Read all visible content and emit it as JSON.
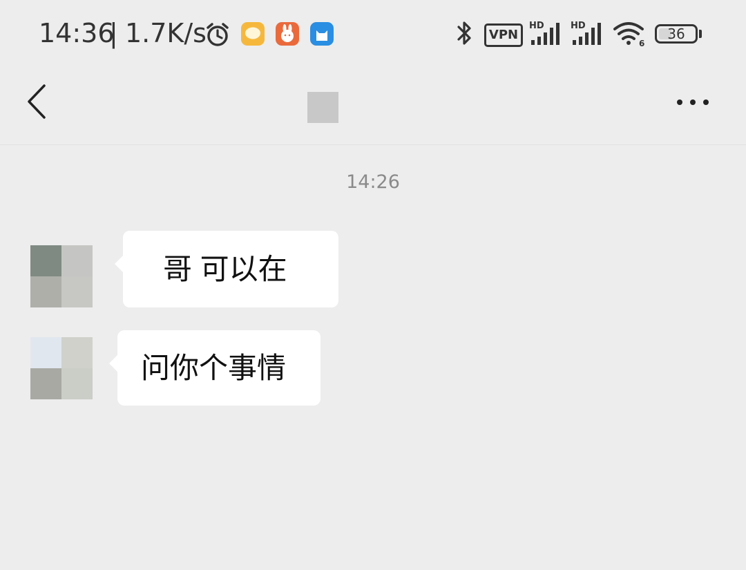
{
  "status_bar": {
    "time": "14:36",
    "separator": "|",
    "network_speed": "1.7K/s",
    "icons": [
      "alarm-icon",
      "messages-app-icon",
      "rabbit-app-icon",
      "cat-app-icon",
      "bluetooth-icon",
      "vpn-badge",
      "signal-hd-icon",
      "signal-hd-icon",
      "wifi-icon",
      "battery-icon"
    ],
    "vpn_label": "VPN",
    "signal_1_label": "HD",
    "signal_2_label": "HD",
    "wifi_label": "6",
    "battery_level": "36",
    "battery_fraction": 0.36
  },
  "nav_bar": {
    "back_icon": "chevron-left-icon",
    "more_icon": "more-horizontal-icon"
  },
  "chat": {
    "timestamp": "14:26",
    "messages": [
      {
        "sender": "contact",
        "text": "哥  可以在"
      },
      {
        "sender": "contact",
        "text": "问你个事情"
      }
    ]
  },
  "colors": {
    "background": "#ededed",
    "bubble": "#ffffff",
    "timestamp": "#8a8a8a",
    "text": "#191919"
  }
}
